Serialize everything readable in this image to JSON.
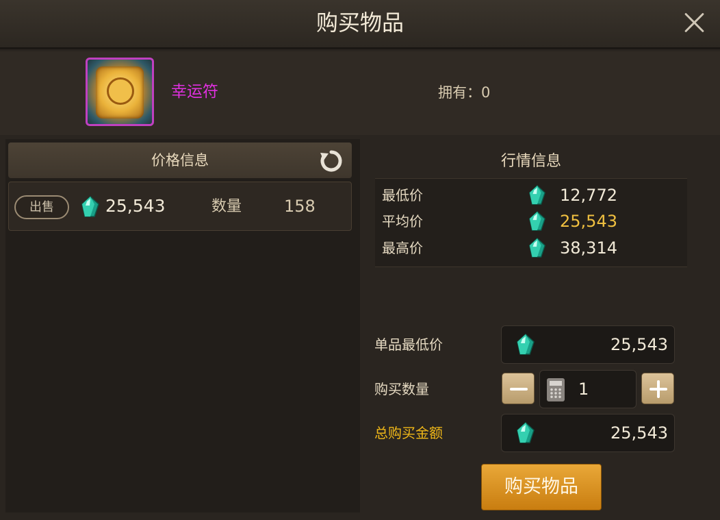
{
  "window": {
    "title": "购买物品"
  },
  "item": {
    "name": "幸运符",
    "owned_label": "拥有：0",
    "name_color": "#e030e0"
  },
  "price_info": {
    "title": "价格信息",
    "listing": {
      "badge": "出售",
      "price": "25,543",
      "qty_label": "数量",
      "qty_value": "158"
    }
  },
  "market": {
    "title": "行情信息",
    "rows": [
      {
        "label": "最低价",
        "value": "12,772"
      },
      {
        "label": "平均价",
        "value": "25,543",
        "color": "#f0c040"
      },
      {
        "label": "最高价",
        "value": "38,314"
      }
    ]
  },
  "form": {
    "unit_min_label": "单品最低价",
    "unit_min_value": "25,543",
    "qty_label": "购买数量",
    "qty_value": "1",
    "total_label": "总购买金额",
    "total_value": "25,543"
  },
  "buy_button": {
    "label": "购买物品"
  },
  "icons": [
    "close-icon",
    "refresh-icon",
    "gem-icon",
    "calculator-icon",
    "minus-icon",
    "plus-icon"
  ]
}
